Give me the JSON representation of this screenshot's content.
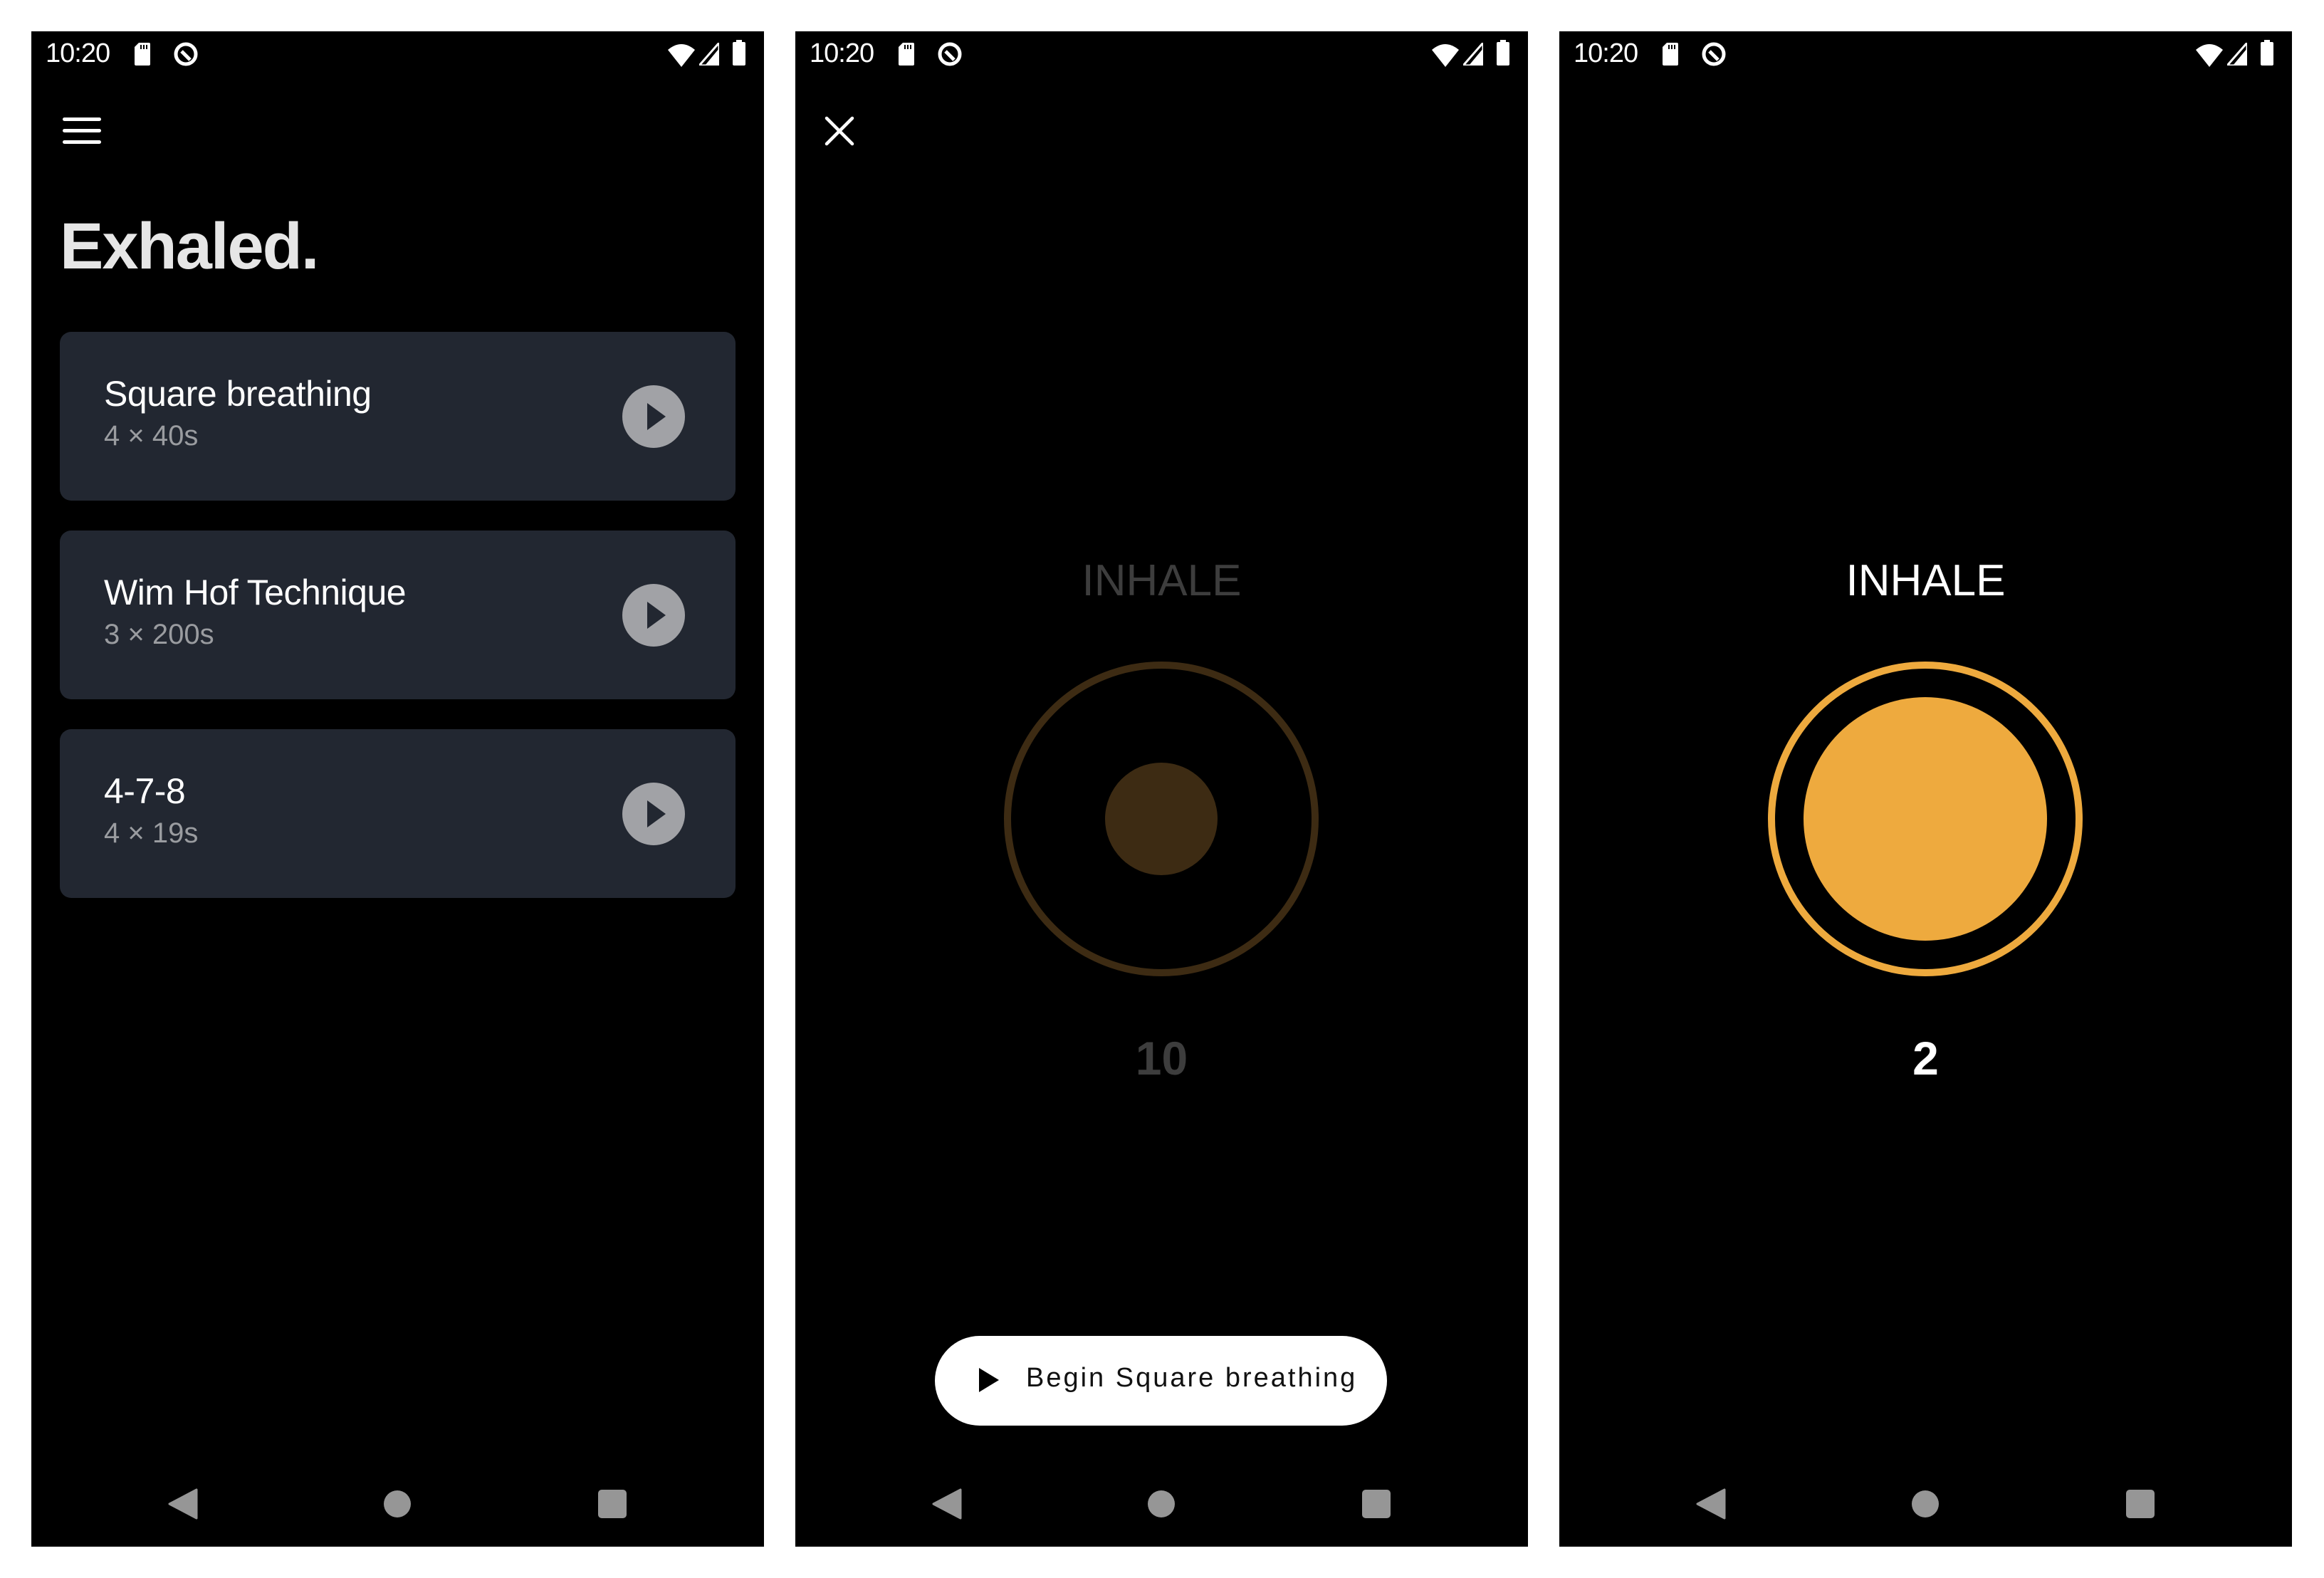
{
  "status_bar": {
    "time": "10:20",
    "left_icons": [
      "sd-card-icon",
      "data-saver-icon"
    ],
    "right_icons": [
      "wifi-icon",
      "cellular-signal-icon",
      "battery-icon"
    ]
  },
  "screens": [
    {
      "id": "home",
      "app_title": "Exhaled.",
      "menu_icon": "hamburger-menu-icon",
      "exercises": [
        {
          "title": "Square breathing",
          "subtitle": "4 × 40s",
          "action_icon": "play-icon"
        },
        {
          "title": "Wim Hof Technique",
          "subtitle": "3 × 200s",
          "action_icon": "play-icon"
        },
        {
          "title": "4-7-8",
          "subtitle": "4 × 19s",
          "action_icon": "play-icon"
        }
      ]
    },
    {
      "id": "session-ready",
      "close_icon": "close-icon",
      "phase": "INHALE",
      "count": "10",
      "active": false,
      "begin_button_label": "Begin Square breathing",
      "begin_button_icon": "play-icon"
    },
    {
      "id": "session-active",
      "phase": "INHALE",
      "count": "2",
      "active": true
    }
  ],
  "navigation_bar": [
    "back-icon",
    "home-icon",
    "recents-icon"
  ],
  "colors": {
    "background": "#000000",
    "card": "#222731",
    "card_subtitle": "#9a9ca0",
    "play_button": "#a1a2a6",
    "accent": "#eeaa3e",
    "accent_dim": "#3d2b13",
    "text_dim": "#3d3d3d",
    "title": "#e6e6e6",
    "nav_icons": "#969696"
  }
}
